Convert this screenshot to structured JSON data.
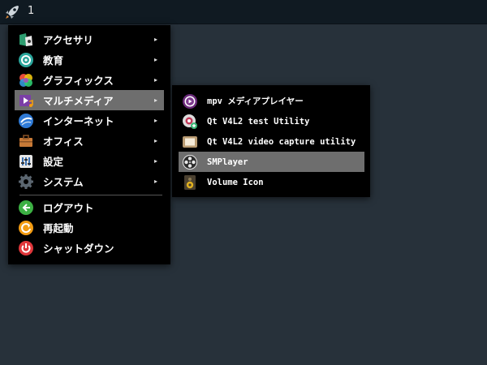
{
  "taskbar": {
    "workspace": "1",
    "launcher_icon": "rocket-icon"
  },
  "main_menu": {
    "items": [
      {
        "label": "アクセサリ",
        "icon": "accessories-icon",
        "submenu": true
      },
      {
        "label": "教育",
        "icon": "education-icon",
        "submenu": true
      },
      {
        "label": "グラフィックス",
        "icon": "graphics-icon",
        "submenu": true
      },
      {
        "label": "マルチメディア",
        "icon": "multimedia-icon",
        "submenu": true,
        "active": true
      },
      {
        "label": "インターネット",
        "icon": "internet-icon",
        "submenu": true
      },
      {
        "label": "オフィス",
        "icon": "office-icon",
        "submenu": true
      },
      {
        "label": "設定",
        "icon": "settings-icon",
        "submenu": true
      },
      {
        "label": "システム",
        "icon": "system-icon",
        "submenu": true
      },
      {
        "label": "ログアウト",
        "icon": "logout-icon",
        "submenu": false
      },
      {
        "label": "再起動",
        "icon": "reboot-icon",
        "submenu": false
      },
      {
        "label": "シャットダウン",
        "icon": "shutdown-icon",
        "submenu": false
      }
    ],
    "arrow": "▸"
  },
  "sub_menu": {
    "items": [
      {
        "label": "mpv メディアプレイヤー",
        "icon": "mpv-icon"
      },
      {
        "label": "Qt V4L2 test Utility",
        "icon": "qv4l2-icon"
      },
      {
        "label": "Qt V4L2 video capture utility",
        "icon": "qvidcap-icon"
      },
      {
        "label": "SMPlayer",
        "icon": "smplayer-icon",
        "active": true
      },
      {
        "label": "Volume Icon",
        "icon": "volume-icon"
      }
    ]
  },
  "colors": {
    "background": "#27313a",
    "taskbar": "#101a22",
    "menu": "#000000",
    "highlight": "#6e6e6e"
  }
}
